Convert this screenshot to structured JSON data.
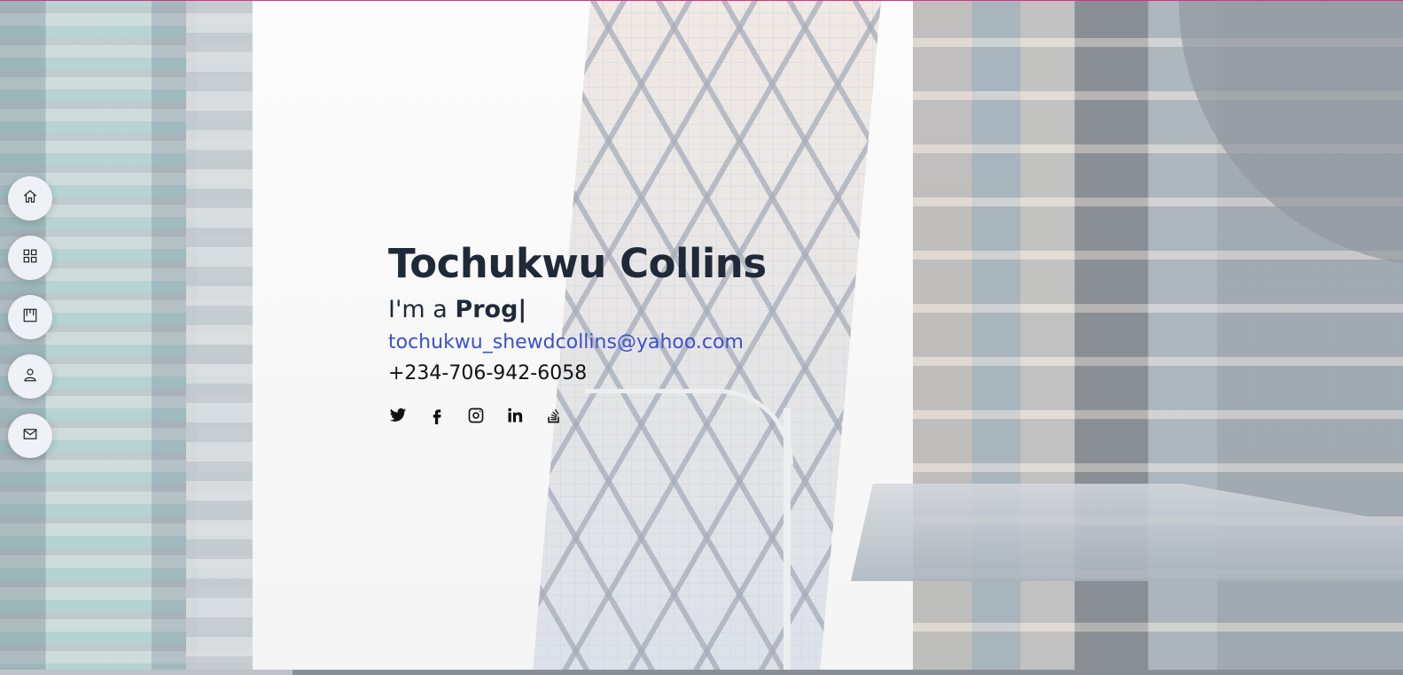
{
  "hero": {
    "name": "Tochukwu Collins",
    "tagline_prefix": "I'm a",
    "tagline_typed": "Prog|",
    "email": "tochukwu_shewdcollins@yahoo.com",
    "phone": "+234-706-942-6058"
  },
  "nav": {
    "items": [
      {
        "icon": "home-icon"
      },
      {
        "icon": "grid-icon"
      },
      {
        "icon": "kanban-icon"
      },
      {
        "icon": "person-icon"
      },
      {
        "icon": "mail-icon"
      }
    ]
  },
  "socials": [
    {
      "icon": "twitter-icon"
    },
    {
      "icon": "facebook-icon"
    },
    {
      "icon": "instagram-icon"
    },
    {
      "icon": "linkedin-icon"
    },
    {
      "icon": "stackoverflow-icon"
    }
  ],
  "colors": {
    "accent_email": "#3a4fd4",
    "top_border": "#d63384",
    "heading": "#1f2937"
  }
}
